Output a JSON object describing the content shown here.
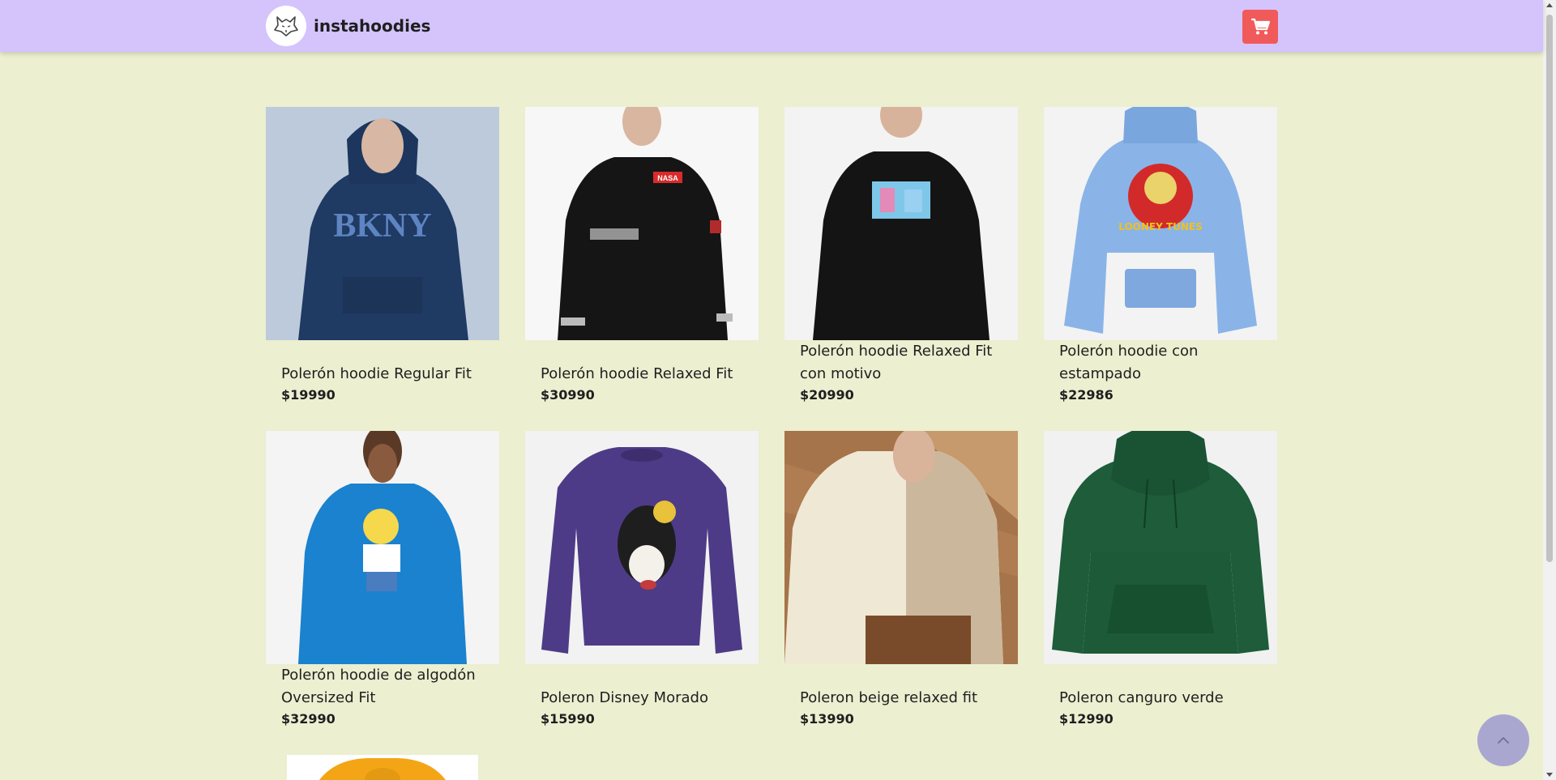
{
  "header": {
    "brand": "instahoodies",
    "logo_icon": "wolf-logo-icon",
    "cart_icon": "shopping-cart-icon",
    "background": "#d4c4fb",
    "cart_color": "#f15a5a"
  },
  "products": [
    {
      "name": "Polerón hoodie Regular Fit",
      "price": "$19990",
      "image": "navy BKNY hoodie"
    },
    {
      "name": "Polerón hoodie Relaxed Fit",
      "price": "$30990",
      "image": "black NASA hoodie"
    },
    {
      "name": "Polerón hoodie Relaxed Fit con motivo",
      "price": "$20990",
      "image": "black hoodie with print"
    },
    {
      "name": "Polerón hoodie con estampado",
      "price": "$22986",
      "image": "light blue Looney Tunes hoodie"
    },
    {
      "name": "Polerón hoodie de algodón Oversized Fit",
      "price": "$32990",
      "image": "blue Simpsons hoodie"
    },
    {
      "name": "Poleron Disney Morado",
      "price": "$15990",
      "image": "purple Goofy sweatshirt"
    },
    {
      "name": "Poleron beige relaxed fit",
      "price": "$13990",
      "image": "beige relaxed hoodie"
    },
    {
      "name": "Poleron canguro verde",
      "price": "$12990",
      "image": "green kangaroo hoodie"
    }
  ],
  "scroll_to_top_icon": "chevron-up-icon",
  "page_background": "#ecefd0"
}
